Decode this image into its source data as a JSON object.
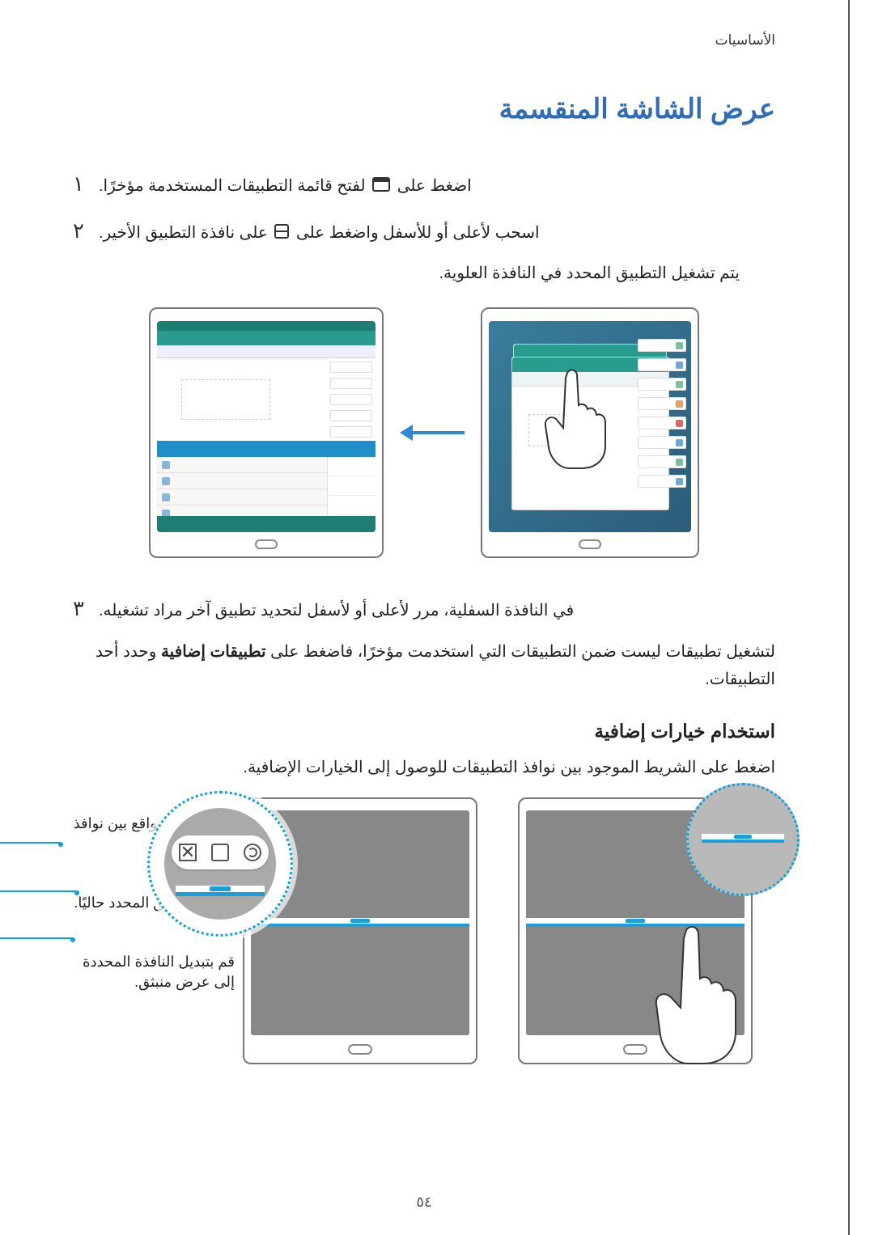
{
  "header": {
    "section": "الأساسيات"
  },
  "title": "عرض الشاشة المنقسمة",
  "steps": {
    "s1_num": "١",
    "s1_text_a": "اضغط على",
    "s1_text_b": "لفتح قائمة التطبيقات المستخدمة مؤخرًا.",
    "s2_num": "٢",
    "s2_text_a": "اسحب لأعلى أو للأسفل واضغط على",
    "s2_text_b": "على نافذة التطبيق الأخير.",
    "s2_sub": "يتم تشغيل التطبيق المحدد في النافذة العلوية.",
    "s3_num": "٣",
    "s3_text": "في النافذة السفلية، مرر لأعلى أو لأسفل لتحديد تطبيق آخر مراد تشغيله.",
    "s3_sub_a": "لتشغيل تطبيقات ليست ضمن التطبيقات التي استخدمت مؤخرًا، فاضغط على",
    "s3_sub_bold": "تطبيقات إضافية",
    "s3_sub_b": "وحدد أحد التطبيقات."
  },
  "section2": {
    "title": "استخدام خيارات إضافية",
    "para": "اضغط على الشريط الموجود بين نوافذ التطبيقات للوصول إلى الخيارات الإضافية."
  },
  "callouts": {
    "c1": "قم بتبديل المواقع بين نوافذ التطبيقات.",
    "c2": "إغلاق التطبيق المحدد حاليًا.",
    "c3": "قم بتبديل النافذة المحددة إلى عرض منبثق."
  },
  "page_number": "٥٤"
}
